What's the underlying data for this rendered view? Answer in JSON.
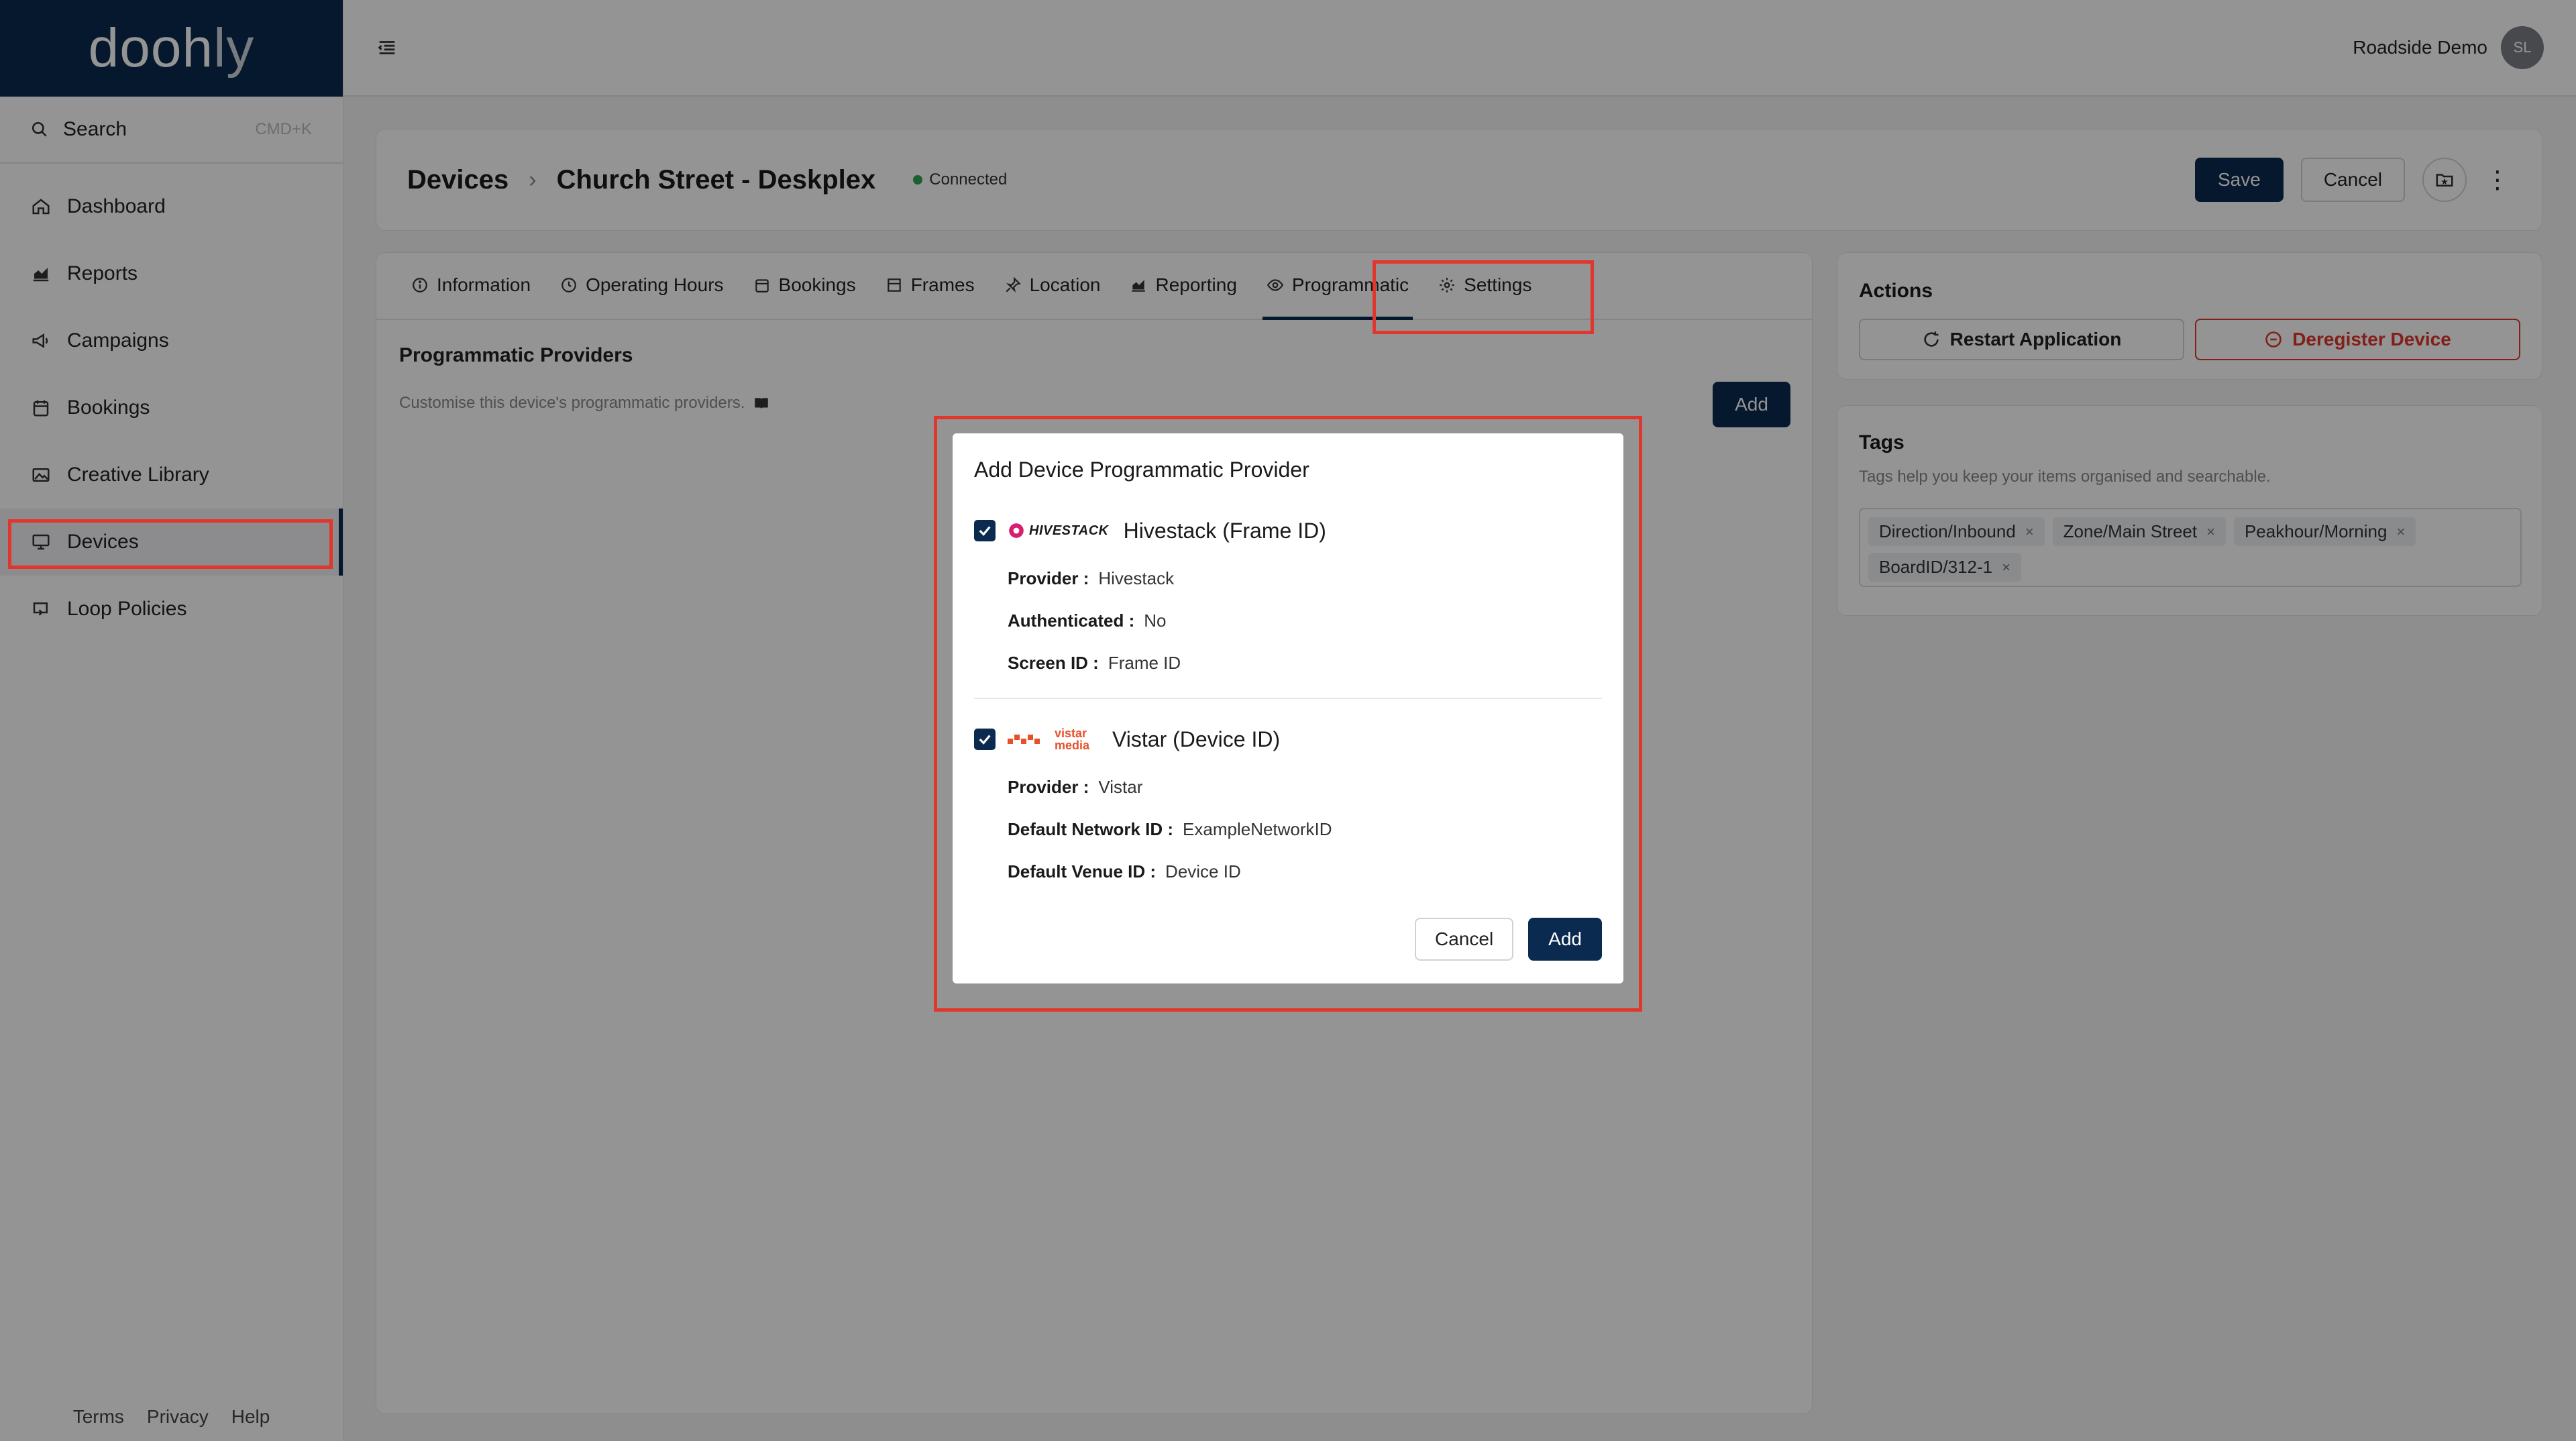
{
  "app": {
    "logo_main": "dooh",
    "logo_dim": "ly"
  },
  "sidebar": {
    "search_label": "Search",
    "search_shortcut": "CMD+K",
    "items": [
      {
        "label": "Dashboard",
        "icon": "home-icon"
      },
      {
        "label": "Reports",
        "icon": "chart-icon"
      },
      {
        "label": "Campaigns",
        "icon": "megaphone-icon"
      },
      {
        "label": "Bookings",
        "icon": "calendar-icon"
      },
      {
        "label": "Creative Library",
        "icon": "image-icon"
      },
      {
        "label": "Devices",
        "icon": "monitor-icon"
      },
      {
        "label": "Loop Policies",
        "icon": "loop-icon"
      }
    ],
    "footer": {
      "terms": "Terms",
      "privacy": "Privacy",
      "help": "Help"
    }
  },
  "topbar": {
    "user_name": "Roadside Demo",
    "avatar_initials": "SL"
  },
  "header": {
    "breadcrumb_root": "Devices",
    "breadcrumb_current": "Church Street - Deskplex",
    "status": "Connected",
    "save_label": "Save",
    "cancel_label": "Cancel"
  },
  "tabs": [
    {
      "label": "Information",
      "icon": "info-icon"
    },
    {
      "label": "Operating Hours",
      "icon": "clock-icon"
    },
    {
      "label": "Bookings",
      "icon": "calendar-icon"
    },
    {
      "label": "Frames",
      "icon": "frame-icon"
    },
    {
      "label": "Location",
      "icon": "pin-icon"
    },
    {
      "label": "Reporting",
      "icon": "chart-icon"
    },
    {
      "label": "Programmatic",
      "icon": "eye-icon"
    },
    {
      "label": "Settings",
      "icon": "gear-icon"
    }
  ],
  "programmatic": {
    "title": "Programmatic Providers",
    "description": "Customise this device's programmatic providers.",
    "add_label": "Add"
  },
  "actions": {
    "title": "Actions",
    "restart_label": "Restart Application",
    "deregister_label": "Deregister Device"
  },
  "tags": {
    "title": "Tags",
    "description": "Tags help you keep your items organised and searchable.",
    "items": [
      "Direction/Inbound",
      "Zone/Main Street",
      "Peakhour/Morning",
      "BoardID/312-1"
    ]
  },
  "modal": {
    "title": "Add Device Programmatic Provider",
    "providers": [
      {
        "name": "Hivestack (Frame ID)",
        "logo_text": "HIVESTACK",
        "checked": true,
        "fields": [
          {
            "label": "Provider :",
            "value": "Hivestack"
          },
          {
            "label": "Authenticated :",
            "value": "No"
          },
          {
            "label": "Screen ID :",
            "value": "Frame ID"
          }
        ]
      },
      {
        "name": "Vistar (Device ID)",
        "logo_text": "vistar media",
        "checked": true,
        "fields": [
          {
            "label": "Provider :",
            "value": "Vistar"
          },
          {
            "label": "Default Network ID :",
            "value": "ExampleNetworkID"
          },
          {
            "label": "Default Venue ID :",
            "value": "Device ID"
          }
        ]
      }
    ],
    "cancel_label": "Cancel",
    "add_label": "Add"
  },
  "colors": {
    "brand": "#0b2a4f",
    "highlight": "#e0362c",
    "status_ok": "#2ea44f"
  }
}
